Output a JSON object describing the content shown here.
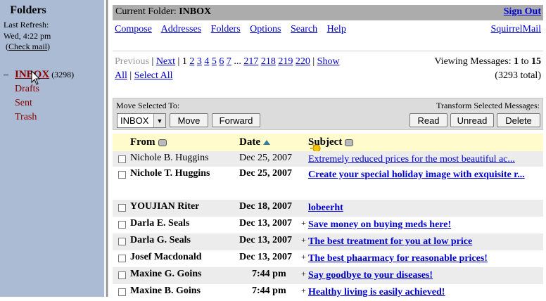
{
  "sidebar": {
    "title": "Folders",
    "refresh_label": "Last Refresh:",
    "refresh_time": "Wed, 4:22 pm",
    "check_mail": "Check mail",
    "folders": [
      {
        "name": "INBOX",
        "count": "(3298)",
        "current": true
      },
      {
        "name": "Drafts"
      },
      {
        "name": "Sent"
      },
      {
        "name": "Trash"
      }
    ]
  },
  "header": {
    "current_folder_label": "Current Folder:",
    "current_folder": "INBOX",
    "sign_out": "Sign Out"
  },
  "menu": {
    "items": [
      "Compose",
      "Addresses",
      "Folders",
      "Options",
      "Search",
      "Help"
    ],
    "brand": "SquirrelMail"
  },
  "pagination": {
    "previous": "Previous",
    "next": "Next",
    "pages": [
      "1",
      "2",
      "3",
      "4",
      "5",
      "6",
      "7"
    ],
    "ellipsis": "...",
    "pages_end": [
      "217",
      "218",
      "219",
      "220"
    ],
    "show": "Show",
    "all": "All",
    "select_all": "Select All",
    "viewing_prefix": "Viewing Messages:",
    "viewing_from": "1",
    "viewing_to_word": "to",
    "viewing_to": "15",
    "total": "(3293 total)"
  },
  "actions": {
    "move_label": "Move Selected To:",
    "folder_value": "INBOX",
    "move": "Move",
    "forward": "Forward",
    "transform_label": "Transform Selected Messages:",
    "read": "Read",
    "unread": "Unread",
    "delete": "Delete"
  },
  "columns": {
    "from": "From",
    "date": "Date",
    "subject": "Subject"
  },
  "messages": [
    {
      "from": "Nichole B. Huggins",
      "date": "Dec 25, 2007",
      "plus": "",
      "subject": "Extremely reduced prices for the most beautiful ac...",
      "unread": false
    },
    {
      "from": "Nichole T. Huggins",
      "date": "Dec 25, 2007",
      "plus": "",
      "subject": "Create your special holiday image with exquisite r...",
      "unread": true
    },
    {
      "from": "YOUJIAN Riter",
      "date": "Dec 18, 2007",
      "plus": "",
      "subject": "lobeerht",
      "unread": true
    },
    {
      "from": "Darla E. Seals",
      "date": "Dec 13, 2007",
      "plus": "+",
      "subject": "Save money on buying meds here!",
      "unread": true
    },
    {
      "from": "Darla G. Seals",
      "date": "Dec 13, 2007",
      "plus": "+",
      "subject": "The best treatment for you at low price",
      "unread": true
    },
    {
      "from": "Josef Macdonald",
      "date": "Dec 13, 2007",
      "plus": "+",
      "subject": "The best phaarmacy for reasonable prices!",
      "unread": true
    },
    {
      "from": "Maxine G. Goins",
      "date": "7:44 pm",
      "plus": "+",
      "subject": "Say goodbye to your diseases!",
      "unread": true
    },
    {
      "from": "Maxine B. Goins",
      "date": "7:44 pm",
      "plus": "+",
      "subject": "Healthy living is easily achieved!",
      "unread": true
    }
  ],
  "colors": {
    "sidebar_bg": "#abbbd3",
    "titlebar_bg": "#acacac",
    "header_row_bg": "#fffbcc",
    "row_alt_bg": "#ececec",
    "folder_link": "#880000",
    "link": "#0000cc"
  }
}
